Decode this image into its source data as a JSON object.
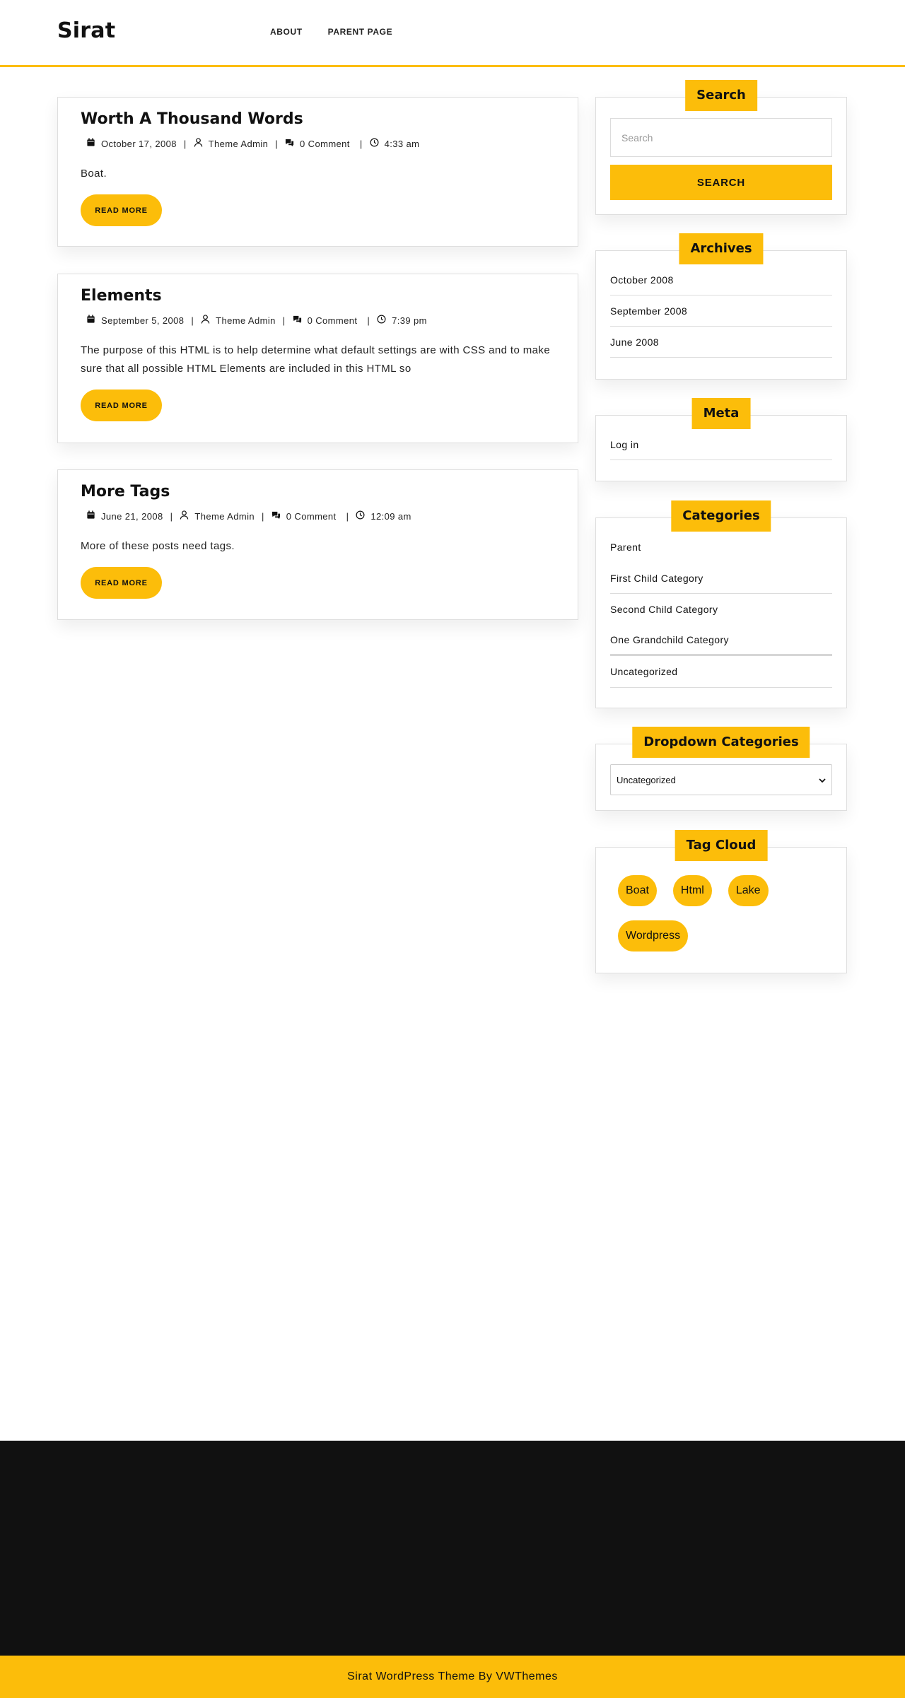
{
  "header": {
    "site_title": "Sirat",
    "nav": [
      "ABOUT",
      "PARENT PAGE"
    ]
  },
  "posts": [
    {
      "title": "Worth A Thousand Words",
      "date": "October 17, 2008",
      "author": "Theme Admin",
      "comments": "0 Comment",
      "time": "4:33 am",
      "excerpt": "Boat.",
      "read_more": "READ MORE"
    },
    {
      "title": "Elements",
      "date": "September 5, 2008",
      "author": "Theme Admin",
      "comments": "0 Comment",
      "time": "7:39 pm",
      "excerpt": "The purpose of this HTML is to help determine what default settings are with CSS and to make sure that all possible HTML Elements are included in this HTML so",
      "read_more": "READ MORE"
    },
    {
      "title": "More Tags",
      "date": "June 21, 2008",
      "author": "Theme Admin",
      "comments": "0 Comment",
      "time": "12:09 am",
      "excerpt": "More of these posts need tags.",
      "read_more": "READ MORE"
    }
  ],
  "sidebar": {
    "search": {
      "title": "Search",
      "placeholder": "Search",
      "button": "SEARCH"
    },
    "archives": {
      "title": "Archives",
      "items": [
        "October 2008",
        "September 2008",
        "June 2008"
      ]
    },
    "meta": {
      "title": "Meta",
      "items": [
        "Log in"
      ]
    },
    "categories": {
      "title": "Categories",
      "items": [
        "Parent",
        "First Child Category",
        "Second Child Category",
        "One Grandchild Category",
        "Uncategorized"
      ]
    },
    "dropdown_categories": {
      "title": "Dropdown Categories",
      "selected": "Uncategorized"
    },
    "tag_cloud": {
      "title": "Tag Cloud",
      "tags": [
        "Boat",
        "Html",
        "Lake",
        "Wordpress"
      ]
    }
  },
  "footer": {
    "copyright": "Sirat WordPress Theme By VWThemes"
  },
  "colors": {
    "accent": "#fcbd0a",
    "footer_bg": "#111111"
  }
}
